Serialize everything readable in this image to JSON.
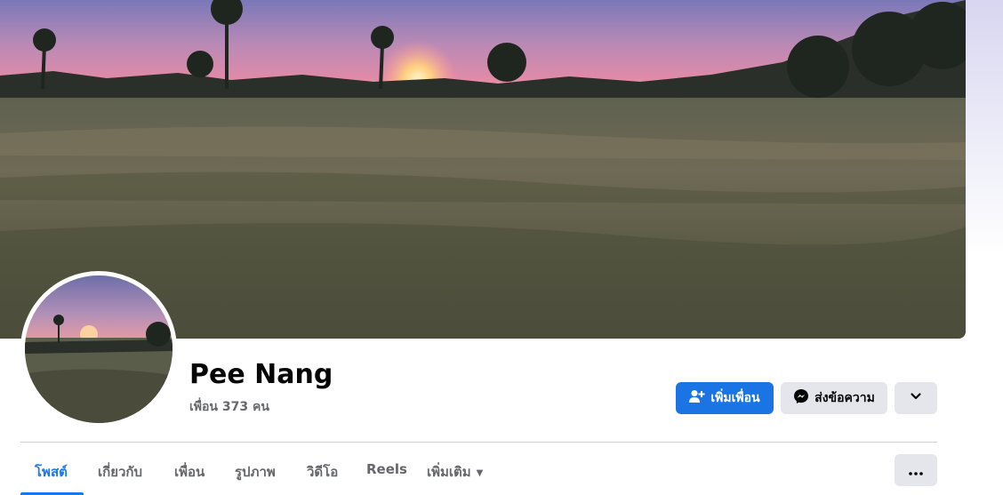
{
  "profile": {
    "name": "Pee Nang",
    "friends_text": "เพื่อน 373 คน"
  },
  "actions": {
    "add_friend_label": "เพิ่มเพื่อน",
    "message_label": "ส่งข้อความ"
  },
  "tabs": [
    {
      "label": "โพสต์",
      "active": true
    },
    {
      "label": "เกี่ยวกับ",
      "active": false
    },
    {
      "label": "เพื่อน",
      "active": false
    },
    {
      "label": "รูปภาพ",
      "active": false
    },
    {
      "label": "วิดีโอ",
      "active": false
    },
    {
      "label": "Reels",
      "active": false
    },
    {
      "label": "เพิ่มเติม",
      "active": false
    }
  ],
  "icons": {
    "add_friend": "person-plus-icon",
    "message": "messenger-icon",
    "dropdown": "chevron-down-icon",
    "more": "ellipsis-icon",
    "more_tab": "caret-down-icon"
  },
  "colors": {
    "accent": "#1877f2",
    "primary_button": "#1b74e4",
    "secondary_button": "#e4e6eb",
    "text_primary": "#050505",
    "text_secondary": "#65676b"
  }
}
